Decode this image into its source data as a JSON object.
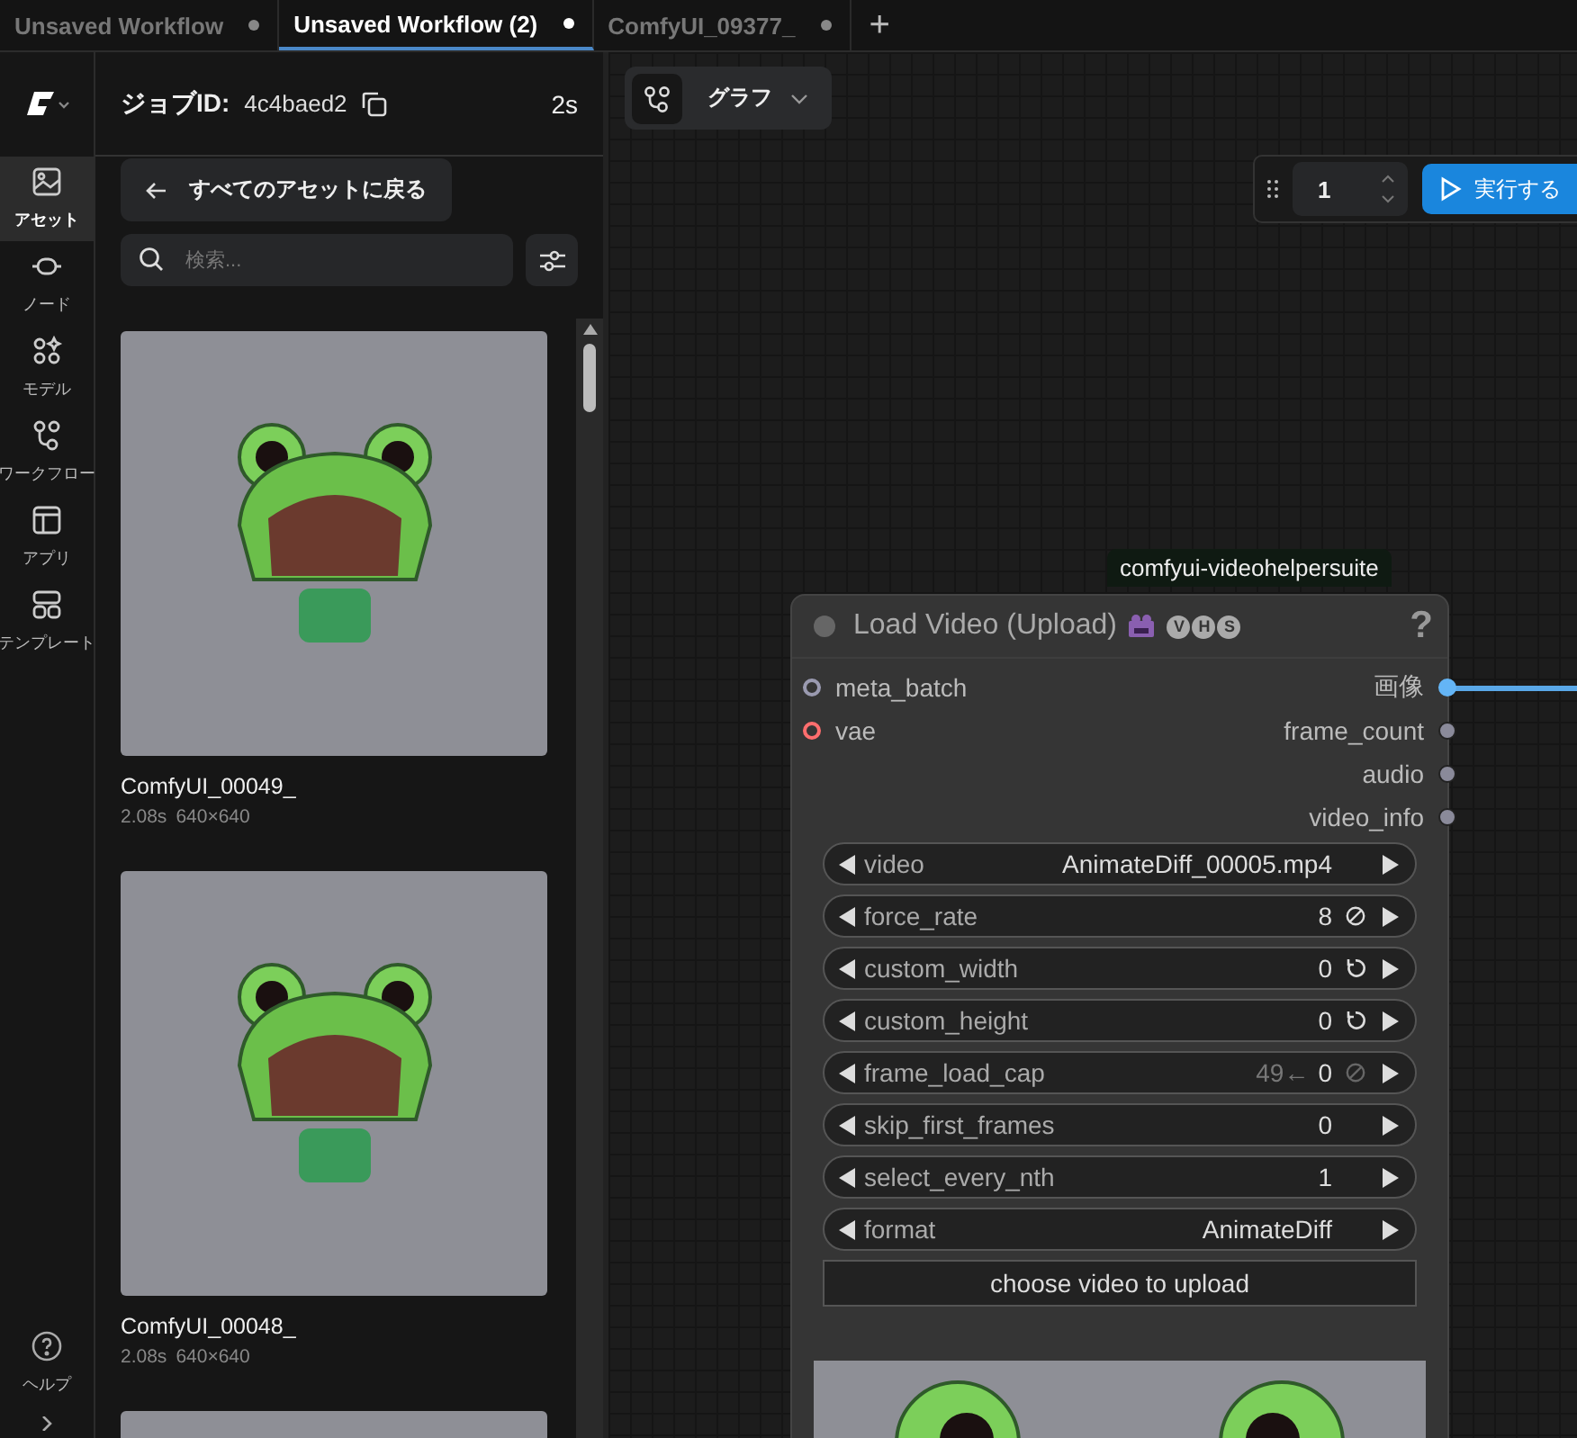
{
  "tabs": [
    {
      "label": "Unsaved Workflow",
      "selected": false,
      "unsaved": true
    },
    {
      "label": "Unsaved Workflow (2)",
      "selected": true,
      "unsaved": true
    },
    {
      "label": "ComfyUI_09377_",
      "selected": false,
      "unsaved": true
    }
  ],
  "new_tab_button": "+",
  "sidebar": {
    "items": [
      {
        "label": "アセット",
        "selected": true
      },
      {
        "label": "ノード",
        "selected": false
      },
      {
        "label": "モデル",
        "selected": false
      },
      {
        "label": "ワークフロー",
        "selected": false
      },
      {
        "label": "アプリ",
        "selected": false
      },
      {
        "label": "テンプレート",
        "selected": false
      }
    ],
    "help": {
      "label": "ヘルプ"
    }
  },
  "asset_panel": {
    "job_label": "ジョブID:",
    "job_id": "4c4baed2",
    "elapsed": "2s",
    "back_button": "すべてのアセットに戻る",
    "search": {
      "placeholder": "検索..."
    },
    "assets": [
      {
        "kind": "captioned",
        "name": "ComfyUI_00049_",
        "duration": "2.08s",
        "size": "640×640"
      },
      {
        "kind": "captioned",
        "name": "ComfyUI_00048_",
        "duration": "2.08s",
        "size": "640×640"
      },
      {
        "kind": "image_only"
      }
    ]
  },
  "canvas": {
    "mode_button": "グラフ",
    "run_toolbar": {
      "batch_count": "1",
      "run_button": "実行する"
    },
    "node": {
      "badge": "comfyui-videohelpersuite",
      "title": "Load Video (Upload)",
      "source_badges": [
        "V",
        "H",
        "S"
      ],
      "help": "?",
      "inputs": [
        {
          "name": "meta_batch",
          "color": "#9a9ab0"
        },
        {
          "name": "vae",
          "color": "#ff6e6e"
        }
      ],
      "outputs": [
        {
          "name": "画像",
          "color": "#64b5f6",
          "connected": true
        },
        {
          "name": "frame_count",
          "color": "#8a8a9a",
          "connected": false
        },
        {
          "name": "audio",
          "color": "#8a8a9a",
          "connected": false
        },
        {
          "name": "video_info",
          "color": "#8a8a9a",
          "connected": false
        }
      ],
      "widgets": [
        {
          "kind": "combo",
          "label": "video",
          "value": "AnimateDiff_00005.mp4"
        },
        {
          "kind": "number_disable",
          "label": "force_rate",
          "value": "8",
          "dimmed": false
        },
        {
          "kind": "number_reset",
          "label": "custom_width",
          "value": "0"
        },
        {
          "kind": "number_reset",
          "label": "custom_height",
          "value": "0"
        },
        {
          "kind": "number_disable",
          "label": "frame_load_cap",
          "value": "0",
          "hint": "49←",
          "dimmed": true
        },
        {
          "kind": "number",
          "label": "skip_first_frames",
          "value": "0"
        },
        {
          "kind": "number",
          "label": "select_every_nth",
          "value": "1"
        },
        {
          "kind": "combo",
          "label": "format",
          "value": "AnimateDiff"
        },
        {
          "kind": "button",
          "label": "choose video to upload"
        }
      ]
    }
  }
}
